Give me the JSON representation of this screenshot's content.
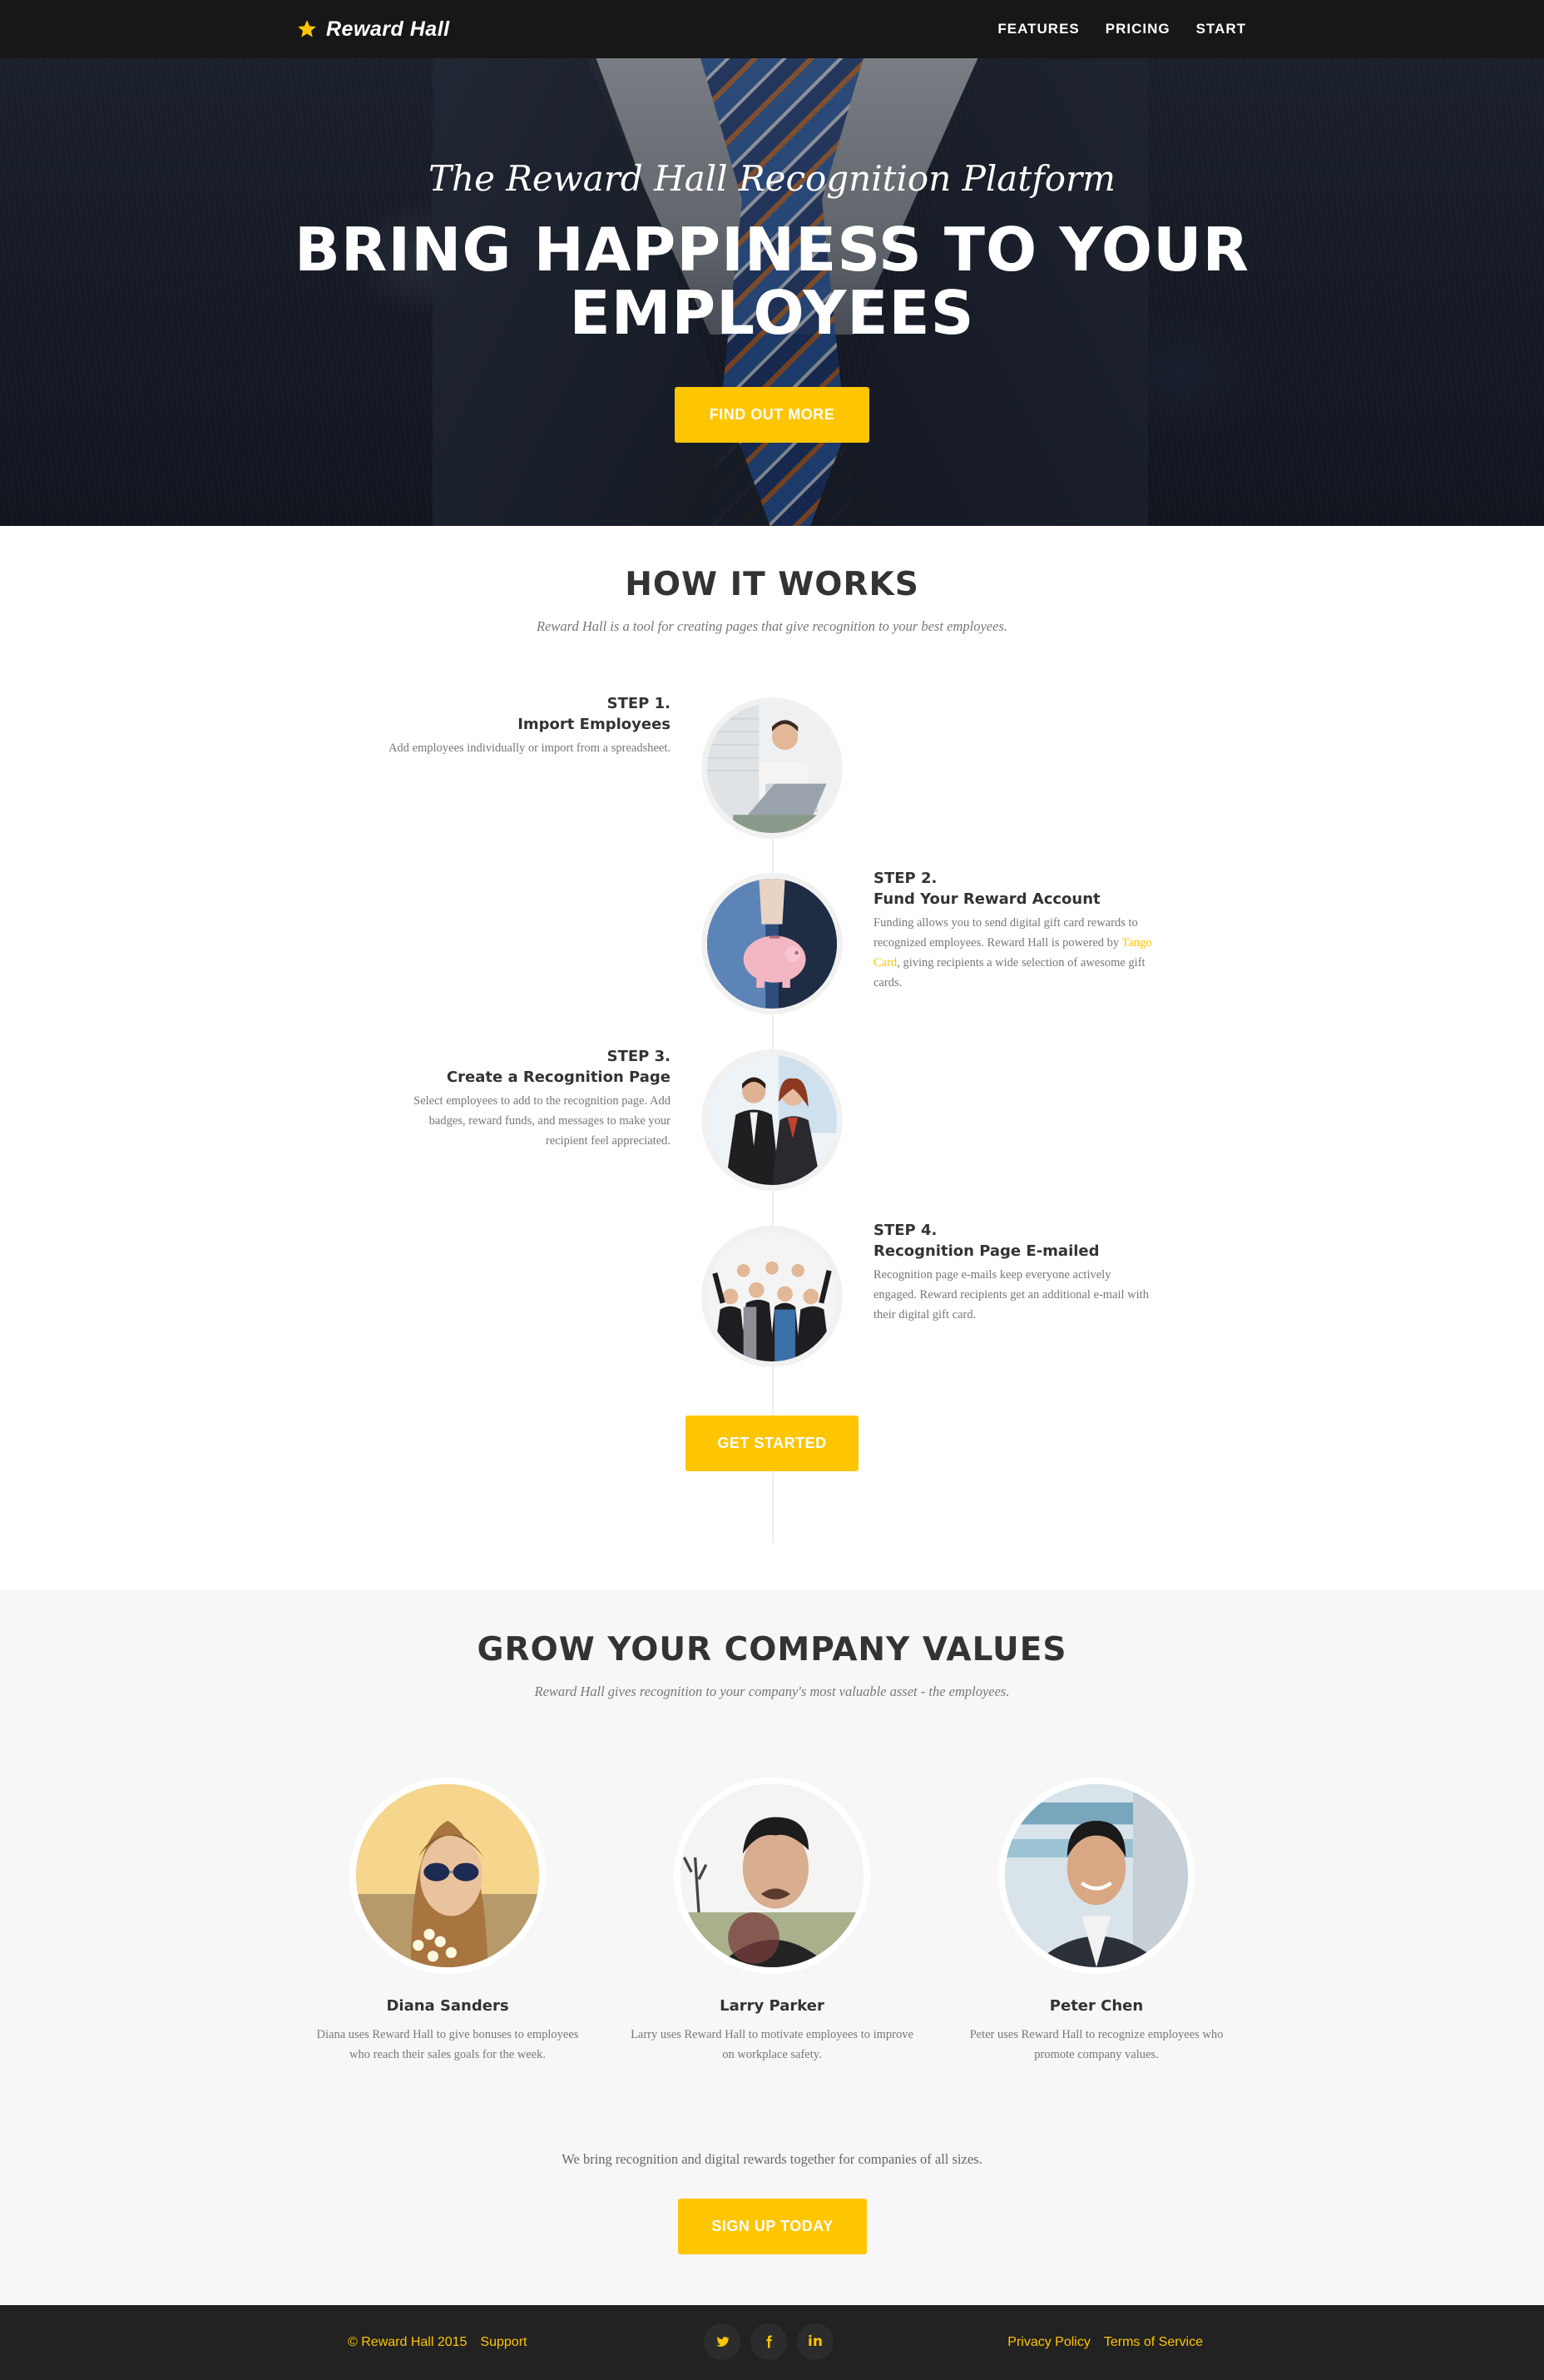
{
  "nav": {
    "brand": "Reward Hall",
    "links": [
      "FEATURES",
      "PRICING",
      "START"
    ]
  },
  "hero": {
    "subtitle": "The Reward Hall Recognition Platform",
    "title_line1": "BRING HAPPINESS TO YOUR",
    "title_line2": "EMPLOYEES",
    "button": "FIND OUT MORE"
  },
  "how": {
    "title": "HOW IT WORKS",
    "subtitle": "Reward Hall is a tool for creating pages that give recognition to your best employees.",
    "steps": [
      {
        "num": "STEP 1.",
        "heading": "Import Employees",
        "desc": "Add employees individually or import from a spreadsheet."
      },
      {
        "num": "STEP 2.",
        "heading": "Fund Your Reward Account",
        "desc_pre": "Funding allows you to send digital gift card rewards to recognized employees. Reward Hall is powered by ",
        "link": "Tango Card",
        "desc_post": ", giving recipients a wide selection of awesome gift cards."
      },
      {
        "num": "STEP 3.",
        "heading": "Create a Recognition Page",
        "desc": "Select employees to add to the recognition page. Add badges, reward funds, and messages to make your recipient feel appreciated."
      },
      {
        "num": "STEP 4.",
        "heading": "Recognition Page E-mailed",
        "desc": "Recognition page e-mails keep everyone actively engaged. Reward recipients get an additional e-mail with their digital gift card."
      }
    ],
    "button": "GET STARTED"
  },
  "values": {
    "title": "GROW YOUR COMPANY VALUES",
    "subtitle": "Reward Hall gives recognition to your company's most valuable asset - the employees.",
    "people": [
      {
        "name": "Diana Sanders",
        "desc": "Diana uses Reward Hall to give bonuses to employees who reach their sales goals for the week."
      },
      {
        "name": "Larry Parker",
        "desc": "Larry uses Reward Hall to motivate employees to improve on workplace safety."
      },
      {
        "name": "Peter Chen",
        "desc": "Peter uses Reward Hall to recognize employees who promote company values."
      }
    ],
    "cta_text": "We bring recognition and digital rewards together for companies of all sizes.",
    "button": "SIGN UP TODAY"
  },
  "footer": {
    "copyright": "© Reward Hall 2015",
    "support": "Support",
    "social": {
      "twitter": "𝕏",
      "facebook": "f",
      "linkedin": "in"
    },
    "privacy": "Privacy Policy",
    "terms": "Terms of Service"
  },
  "colors": {
    "accent": "#fec503",
    "nav_bg": "#171717",
    "footer_bg": "#222222",
    "values_bg": "#f7f7f7"
  }
}
